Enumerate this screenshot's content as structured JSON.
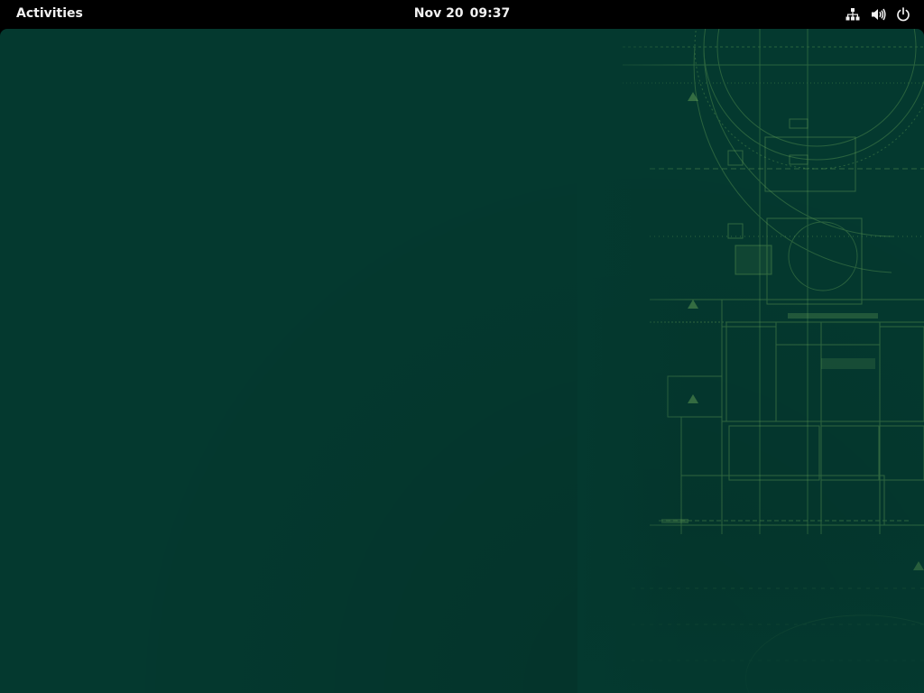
{
  "topbar": {
    "activities_label": "Activities",
    "date": "Nov 20",
    "time": "09:37",
    "tray_icons": [
      "network-wired-icon",
      "volume-icon",
      "power-icon"
    ]
  },
  "colors": {
    "topbar_bg": "#000000",
    "desktop_bg": "#04392f",
    "blueprint_line": "#6fae5a"
  }
}
